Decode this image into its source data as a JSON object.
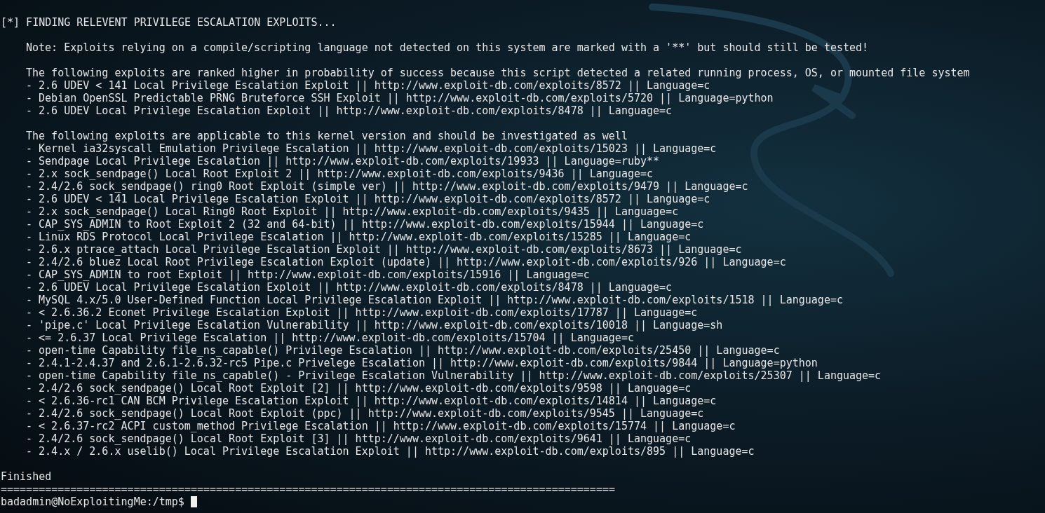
{
  "terminal": {
    "heading": "[*] FINDING RELEVENT PRIVILEGE ESCALATION EXPLOITS...",
    "note": "Note: Exploits relying on a compile/scripting language not detected on this system are marked with a '**' but should still be tested!",
    "sections": [
      {
        "intro": "The following exploits are ranked higher in probability of success because this script detected a related running process, OS, or mounted file system",
        "items": [
          "- 2.6 UDEV < 141 Local Privilege Escalation Exploit || http://www.exploit-db.com/exploits/8572 || Language=c",
          "- Debian OpenSSL Predictable PRNG Bruteforce SSH Exploit || http://www.exploit-db.com/exploits/5720 || Language=python",
          "- 2.6 UDEV Local Privilege Escalation Exploit || http://www.exploit-db.com/exploits/8478 || Language=c"
        ]
      },
      {
        "intro": "The following exploits are applicable to this kernel version and should be investigated as well",
        "items": [
          "- Kernel ia32syscall Emulation Privilege Escalation || http://www.exploit-db.com/exploits/15023 || Language=c",
          "- Sendpage Local Privilege Escalation || http://www.exploit-db.com/exploits/19933 || Language=ruby**",
          "- 2.x sock_sendpage() Local Root Exploit 2 || http://www.exploit-db.com/exploits/9436 || Language=c",
          "- 2.4/2.6 sock_sendpage() ring0 Root Exploit (simple ver) || http://www.exploit-db.com/exploits/9479 || Language=c",
          "- 2.6 UDEV < 141 Local Privilege Escalation Exploit || http://www.exploit-db.com/exploits/8572 || Language=c",
          "- 2.x sock_sendpage() Local Ring0 Root Exploit || http://www.exploit-db.com/exploits/9435 || Language=c",
          "- CAP_SYS_ADMIN to Root Exploit 2 (32 and 64-bit) || http://www.exploit-db.com/exploits/15944 || Language=c",
          "- Linux RDS Protocol Local Privilege Escalation || http://www.exploit-db.com/exploits/15285 || Language=c",
          "- 2.6.x ptrace_attach Local Privilege Escalation Exploit || http://www.exploit-db.com/exploits/8673 || Language=c",
          "- 2.4/2.6 bluez Local Root Privilege Escalation Exploit (update) || http://www.exploit-db.com/exploits/926 || Language=c",
          "- CAP_SYS_ADMIN to root Exploit || http://www.exploit-db.com/exploits/15916 || Language=c",
          "- 2.6 UDEV Local Privilege Escalation Exploit || http://www.exploit-db.com/exploits/8478 || Language=c",
          "- MySQL 4.x/5.0 User-Defined Function Local Privilege Escalation Exploit || http://www.exploit-db.com/exploits/1518 || Language=c",
          "- < 2.6.36.2 Econet Privilege Escalation Exploit || http://www.exploit-db.com/exploits/17787 || Language=c",
          "- 'pipe.c' Local Privilege Escalation Vulnerability || http://www.exploit-db.com/exploits/10018 || Language=sh",
          "- <= 2.6.37 Local Privilege Escalation || http://www.exploit-db.com/exploits/15704 || Language=c",
          "- open-time Capability file_ns_capable() Privilege Escalation || http://www.exploit-db.com/exploits/25450 || Language=c",
          "- 2.4.1-2.4.37 and 2.6.1-2.6.32-rc5 Pipe.c Privelege Escalation || http://www.exploit-db.com/exploits/9844 || Language=python",
          "- open-time Capability file_ns_capable() - Privilege Escalation Vulnerability || http://www.exploit-db.com/exploits/25307 || Language=c",
          "- 2.4/2.6 sock_sendpage() Local Root Exploit [2] || http://www.exploit-db.com/exploits/9598 || Language=c",
          "- < 2.6.36-rc1 CAN BCM Privilege Escalation Exploit || http://www.exploit-db.com/exploits/14814 || Language=c",
          "- 2.4/2.6 sock_sendpage() Local Root Exploit (ppc) || http://www.exploit-db.com/exploits/9545 || Language=c",
          "- < 2.6.37-rc2 ACPI custom_method Privilege Escalation || http://www.exploit-db.com/exploits/15774 || Language=c",
          "- 2.4/2.6 sock_sendpage() Local Root Exploit [3] || http://www.exploit-db.com/exploits/9641 || Language=c",
          "- 2.4.x / 2.6.x uselib() Local Privilege Escalation Exploit || http://www.exploit-db.com/exploits/895 || Language=c"
        ]
      }
    ],
    "footer": "Finished",
    "separator": "=================================================================================================",
    "prompt": "badadmin@NoExploitingMe:/tmp$",
    "cursor": true
  }
}
